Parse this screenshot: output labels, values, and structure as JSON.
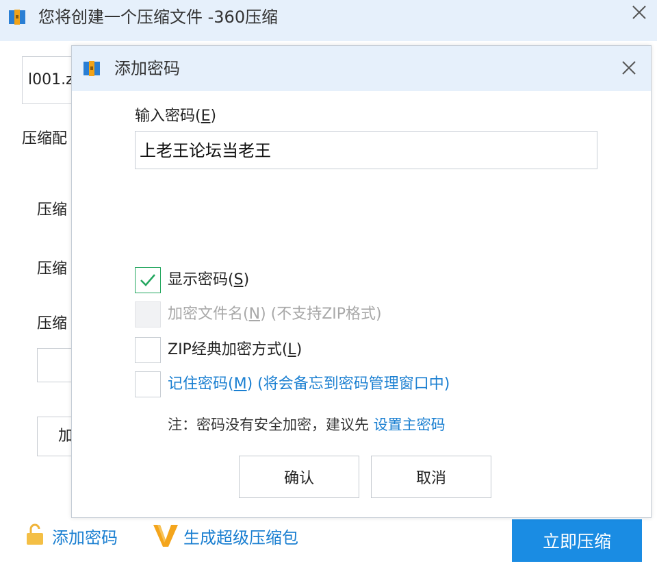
{
  "main": {
    "title": "您将创建一个压缩文件 -360压缩",
    "file_name_value": "l001.z",
    "label_1": "压缩配",
    "label_2": "压缩",
    "label_3": "压缩",
    "label_4": "压缩",
    "partial_button_label": "加",
    "add_password_link": "添加密码",
    "super_package_link": "生成超级压缩包",
    "compress_button": "立即压缩"
  },
  "dialog": {
    "title": "添加密码",
    "password_label": "输入密码(",
    "password_label_key": "E",
    "password_label_end": ")",
    "password_value": "上老王论坛当老王",
    "options": [
      {
        "text": "显示密码(",
        "key": "S",
        "suffix": ")",
        "checked": true,
        "disabled": false
      },
      {
        "text": "加密文件名(",
        "key": "N",
        "suffix": ") (不支持ZIP格式)",
        "checked": false,
        "disabled": true
      },
      {
        "text": "ZIP经典加密方式(",
        "key": "L",
        "suffix": ")",
        "checked": false,
        "disabled": false
      },
      {
        "text": "记住密码(",
        "key": "M",
        "suffix": ") (将会备忘到密码管理窗口中)",
        "checked": false,
        "disabled": false
      }
    ],
    "note_text": "注：密码没有安全加密，建议先 ",
    "note_link": "设置主密码",
    "ok_button": "确认",
    "cancel_button": "取消"
  },
  "colors": {
    "titlebar_bg": "#e6f0fb",
    "link_blue": "#1a7fd1",
    "primary_button": "#1a8ce3",
    "check_green": "#22a65e"
  }
}
